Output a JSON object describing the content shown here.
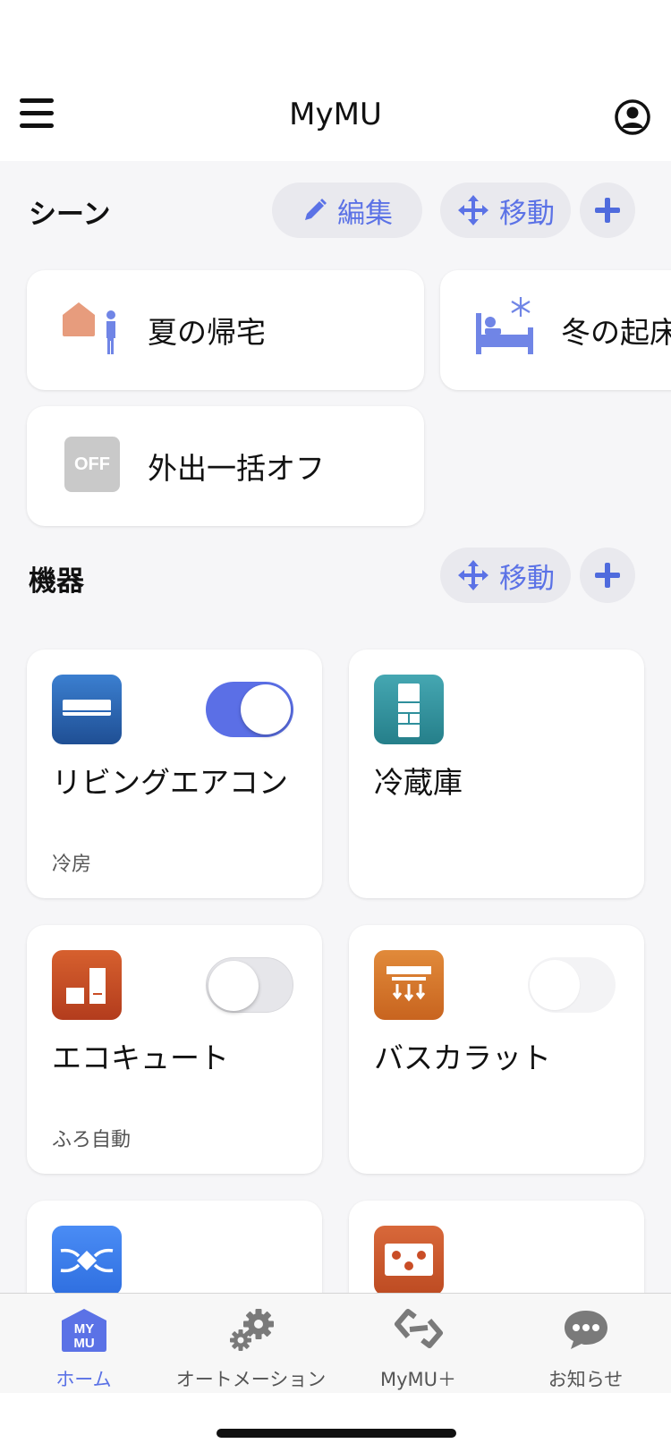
{
  "header": {
    "title": "MyMU",
    "menu_icon": "hamburger-menu-icon",
    "account_icon": "user-circle-icon"
  },
  "scenes": {
    "title": "シーン",
    "edit_label": "編集",
    "move_label": "移動",
    "items": [
      {
        "label": "夏の帰宅",
        "icon": "home-person-icon"
      },
      {
        "label": "冬の起床",
        "icon": "bed-snowflake-icon"
      },
      {
        "label": "外出一括オフ",
        "icon": "off-icon",
        "icon_text": "OFF"
      }
    ]
  },
  "devices": {
    "title": "機器",
    "move_label": "移動",
    "items": [
      {
        "name": "リビングエアコン",
        "status": "冷房",
        "icon": "air-conditioner-icon",
        "toggle": "on"
      },
      {
        "name": "冷蔵庫",
        "status": "",
        "icon": "refrigerator-icon",
        "toggle": "none"
      },
      {
        "name": "エコキュート",
        "status": "ふろ自動",
        "icon": "eco-cute-icon",
        "toggle": "off"
      },
      {
        "name": "バスカラット",
        "status": "",
        "icon": "bath-heater-icon",
        "toggle": "disabled"
      },
      {
        "name": "",
        "status": "",
        "icon": "ventilation-icon",
        "toggle": "none"
      },
      {
        "name": "",
        "status": "",
        "icon": "ih-cooktop-icon",
        "toggle": "none"
      }
    ]
  },
  "tabbar": {
    "items": [
      {
        "label": "ホーム",
        "icon": "mymu-home-icon",
        "icon_text": "MY MU",
        "active": true
      },
      {
        "label": "オートメーション",
        "icon": "gears-icon",
        "active": false
      },
      {
        "label": "MyMU＋",
        "icon": "link-icon",
        "active": false
      },
      {
        "label": "お知らせ",
        "icon": "chat-bubble-icon",
        "active": false
      }
    ]
  },
  "colors": {
    "accent": "#5b72e6",
    "toggle_on": "#5b6fe6",
    "background": "#f6f6f8",
    "aircon_tile": "#2a66b5",
    "fridge_tile": "#2e8f9b",
    "ecocute_tile": "#c94d26",
    "bath_tile": "#d6742a",
    "vent_tile": "#3d7ff2"
  }
}
